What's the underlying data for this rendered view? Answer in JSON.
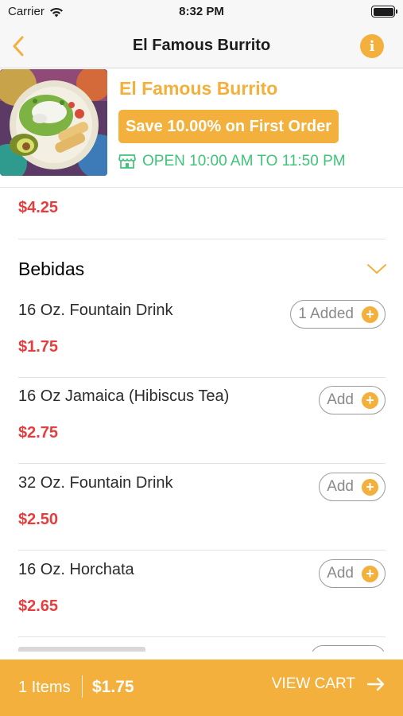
{
  "status_bar": {
    "carrier": "Carrier",
    "time": "8:32 PM"
  },
  "nav": {
    "title": "El Famous Burrito",
    "back_icon": "chevron-left-icon",
    "info_icon": "info-icon",
    "info_glyph": "i"
  },
  "restaurant": {
    "name": "El Famous Burrito",
    "promo": "Save 10.00% on First Order",
    "hours": "OPEN 10:00 AM TO 11:50 PM",
    "store_icon": "store-icon"
  },
  "menu": {
    "previous_item_price": "$4.25",
    "section": {
      "title": "Bebidas",
      "collapse_icon": "chevron-down-icon",
      "items": [
        {
          "name": "16 Oz. Fountain Drink",
          "price": "$1.75",
          "button": "1 Added",
          "plus": "+"
        },
        {
          "name": "16 Oz Jamaica (Hibiscus Tea)",
          "price": "$2.75",
          "button": "Add",
          "plus": "+"
        },
        {
          "name": "32 Oz. Fountain Drink",
          "price": "$2.50",
          "button": "Add",
          "plus": "+"
        },
        {
          "name": "16 Oz. Horchata",
          "price": "$2.65",
          "button": "Add",
          "plus": "+"
        }
      ]
    }
  },
  "cart": {
    "items": "1 Items",
    "total": "$1.75",
    "view_cart": "VIEW CART",
    "arrow_icon": "arrow-right-icon"
  },
  "colors": {
    "accent": "#f4b03d",
    "price": "#e53e3e",
    "open": "#3fc47a"
  }
}
